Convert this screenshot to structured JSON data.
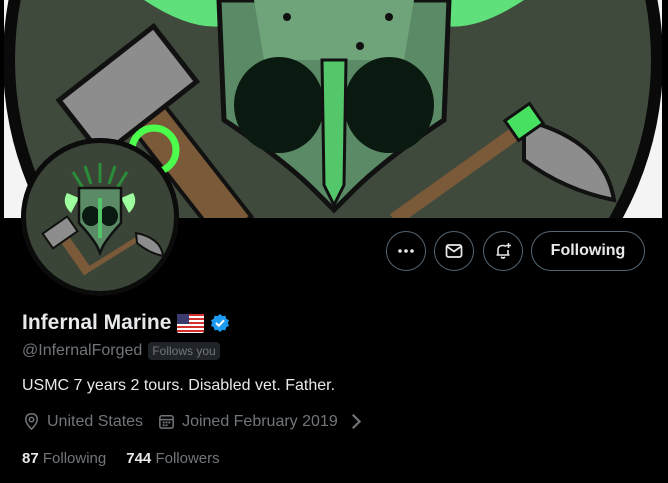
{
  "profile": {
    "display_name": "Infernal Marine",
    "handle": "@InfernalForged",
    "follows_you": "Follows you",
    "bio": "USMC 7 years 2 tours. Disabled vet. Father.",
    "location": "United States",
    "joined": "Joined February 2019",
    "following_count": "87",
    "following_label": "Following",
    "followers_count": "744",
    "followers_label": "Followers"
  },
  "actions": {
    "following_button": "Following"
  },
  "icons": {
    "more": "more-icon",
    "message": "message-icon",
    "notify": "notification-bell-icon",
    "verified": "verified-badge-icon",
    "flag": "us-flag-icon",
    "location": "location-pin-icon",
    "calendar": "calendar-icon"
  },
  "colors": {
    "background": "#000000",
    "text_primary": "#e7e9ea",
    "text_secondary": "#71767b",
    "border": "#536471",
    "verified_blue": "#1d9bf0",
    "accent_green": "#39e05a"
  }
}
